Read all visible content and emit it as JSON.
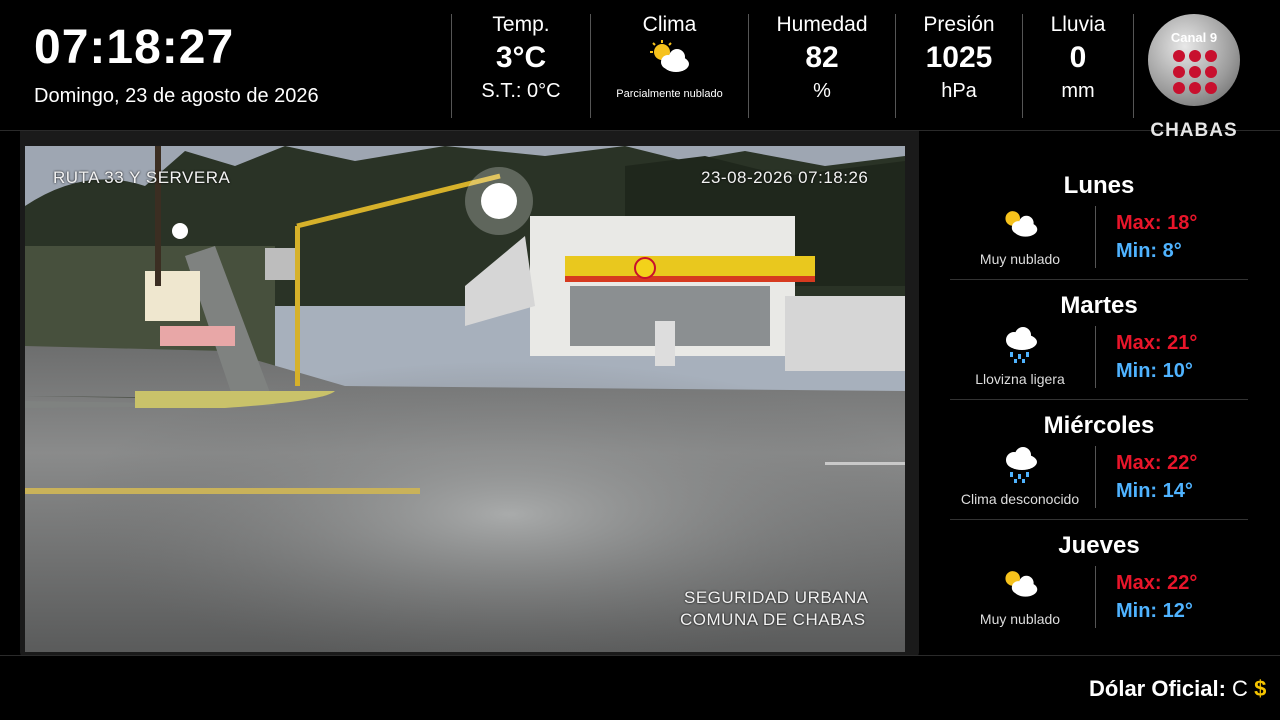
{
  "header": {
    "time": "07:18:27",
    "date": "Domingo, 23 de agosto de 2026",
    "temp": {
      "label": "Temp.",
      "value": "3°C",
      "feels": "S.T.: 0°C"
    },
    "clima": {
      "label": "Clima",
      "icon": "partly-cloudy-icon",
      "desc": "Parcialmente nublado"
    },
    "humedad": {
      "label": "Humedad",
      "value": "82",
      "unit": "%"
    },
    "presion": {
      "label": "Presión",
      "value": "1025",
      "unit": "hPa"
    },
    "lluvia": {
      "label": "Lluvia",
      "value": "0",
      "unit": "mm"
    },
    "logo": {
      "canal": "Canal 9",
      "name": "CHABAS"
    }
  },
  "camera": {
    "location": "RUTA 33 Y SERVERA",
    "timestamp": "23-08-2026 07:18:26",
    "credit_line1": "SEGURIDAD URBANA",
    "credit_line2": "COMUNA DE CHABAS"
  },
  "forecast": [
    {
      "day": "Lunes",
      "icon": "partly-cloudy-icon",
      "desc": "Muy nublado",
      "max": "Max: 18°",
      "min": "Min: 8°"
    },
    {
      "day": "Martes",
      "icon": "rain-cloud-icon",
      "desc": "Llovizna ligera",
      "max": "Max: 21°",
      "min": "Min: 10°"
    },
    {
      "day": "Miércoles",
      "icon": "rain-cloud-icon",
      "desc": "Clima desconocido",
      "max": "Max: 22°",
      "min": "Min: 14°"
    },
    {
      "day": "Jueves",
      "icon": "partly-cloudy-icon",
      "desc": "Muy nublado",
      "max": "Max: 22°",
      "min": "Min: 12°"
    }
  ],
  "ticker": {
    "label": "Dólar Oficial:",
    "text": "C",
    "money": "$"
  },
  "colors": {
    "max": "#e8152a",
    "min": "#4fb3ff",
    "ticker_money": "#f5c400",
    "logo_red": "#c8102e"
  }
}
